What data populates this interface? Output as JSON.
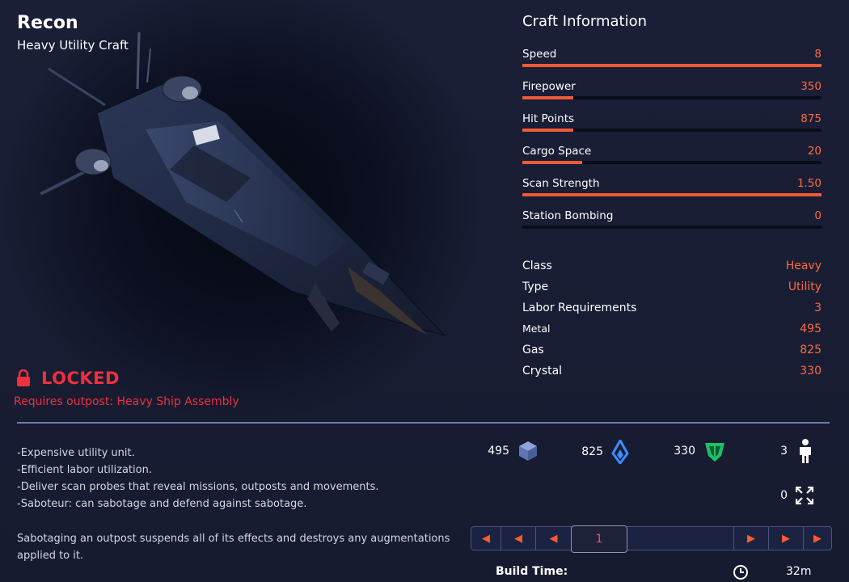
{
  "craft": {
    "name": "Recon",
    "class_subtitle": "Heavy Utility Craft"
  },
  "lock": {
    "status": "LOCKED",
    "requirement": "Requires outpost: Heavy Ship Assembly"
  },
  "info": {
    "title": "Craft Information",
    "stats": [
      {
        "label": "Speed",
        "value": "8",
        "fill": 1.0
      },
      {
        "label": "Firepower",
        "value": "350",
        "fill": 0.17
      },
      {
        "label": "Hit Points",
        "value": "875",
        "fill": 0.17
      },
      {
        "label": "Cargo Space",
        "value": "20",
        "fill": 0.2
      },
      {
        "label": "Scan Strength",
        "value": "1.50",
        "fill": 1.0
      },
      {
        "label": "Station Bombing",
        "value": "0",
        "fill": 0
      }
    ],
    "attributes": [
      {
        "label": "Class",
        "value": "Heavy"
      },
      {
        "label": "Type",
        "value": "Utility"
      },
      {
        "label": "Labor Requirements",
        "value": "3"
      },
      {
        "label": "Metal",
        "value": "495"
      },
      {
        "label": "Gas",
        "value": "825"
      },
      {
        "label": "Crystal",
        "value": "330"
      }
    ]
  },
  "description": {
    "lines": [
      "-Expensive utility unit.",
      "-Efficient labor utilization.",
      "-Deliver scan probes that reveal missions, outposts and movements.",
      "-Saboteur: can sabotage and defend against sabotage."
    ],
    "note_line1": "Sabotaging an outpost suspends all of its effects and destroys any augmentations",
    "note_line2": "applied to it."
  },
  "costs": {
    "metal": "495",
    "gas": "825",
    "crystal": "330",
    "labor": "3",
    "queued": "0"
  },
  "pager": {
    "current": "1",
    "icons": [
      "triple-left-icon",
      "double-left-icon",
      "left-icon",
      "right-icon",
      "double-right-icon",
      "triple-right-icon"
    ]
  },
  "build": {
    "label": "Build Time:",
    "value": "32m"
  },
  "colors": {
    "accent_orange": "#ff6a3d",
    "locked_red": "#f0303c",
    "metal_blue": "#6f86c6",
    "gas_blue": "#3d8cff",
    "crystal_green": "#1fbf66"
  }
}
